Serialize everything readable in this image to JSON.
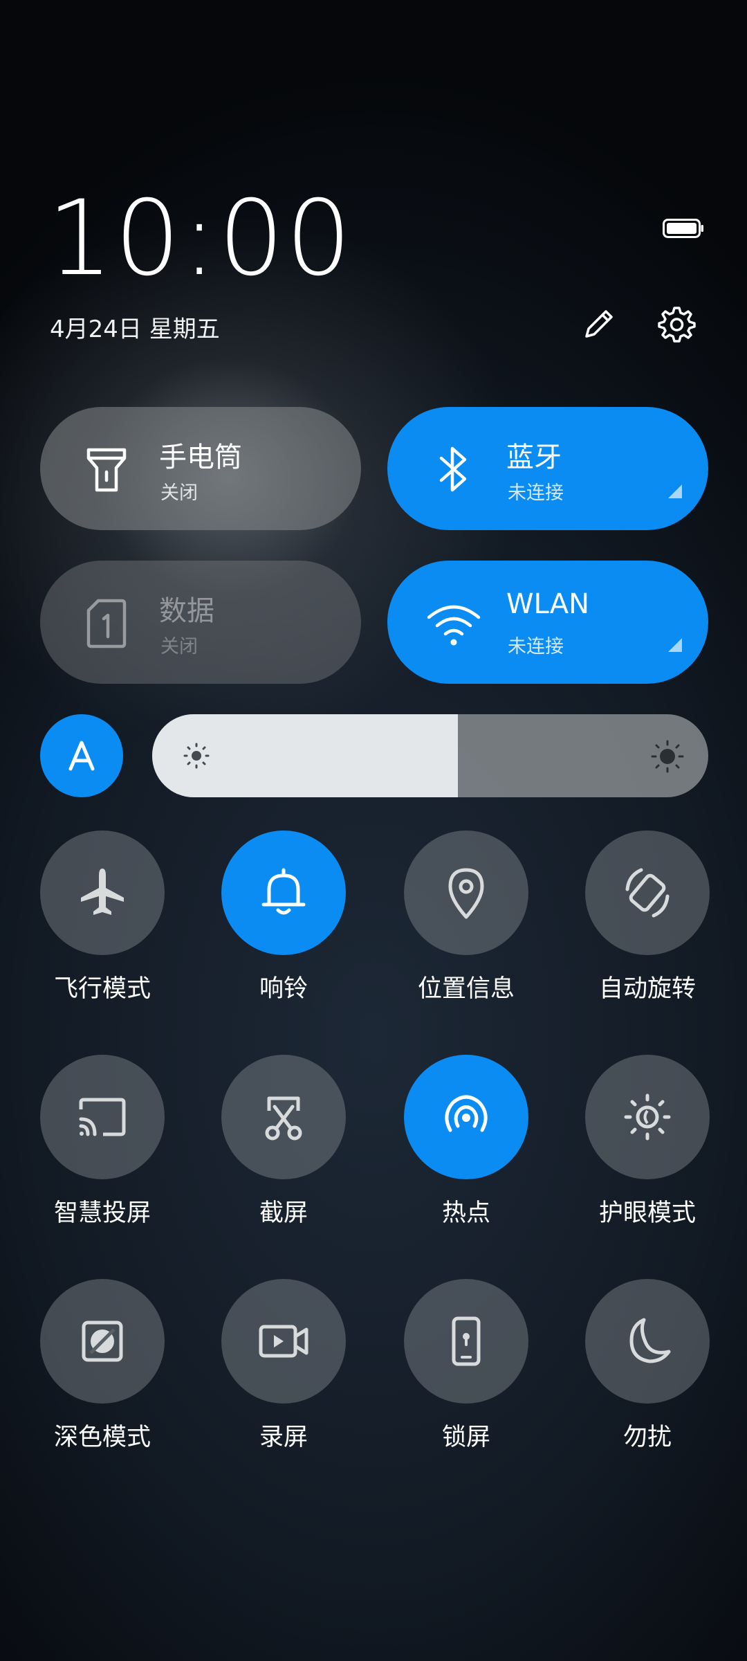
{
  "status": {
    "time": "10:00",
    "date": "4月24日 星期五",
    "icons": [
      "battery-icon",
      "edit-icon",
      "settings-icon"
    ]
  },
  "colors": {
    "accent": "#0a8cf2",
    "tile_off": "#7f8285",
    "icon_off": "#d8dadc"
  },
  "tiles": {
    "flashlight": {
      "title": "手电筒",
      "sub": "关闭",
      "icon": "flashlight-icon"
    },
    "bluetooth": {
      "title": "蓝牙",
      "sub": "未连接",
      "icon": "bluetooth-icon"
    },
    "data": {
      "title": "数据",
      "sub": "关闭",
      "icon": "sim-card-icon"
    },
    "wlan": {
      "title": "WLAN",
      "sub": "未连接",
      "icon": "wifi-icon"
    }
  },
  "brightness": {
    "auto_label": "A",
    "level": 0.55
  },
  "toggles": [
    {
      "label": "飞行模式",
      "icon": "airplane-icon",
      "on": false
    },
    {
      "label": "响铃",
      "icon": "bell-icon",
      "on": true
    },
    {
      "label": "位置信息",
      "icon": "location-icon",
      "on": false
    },
    {
      "label": "自动旋转",
      "icon": "rotate-icon",
      "on": false
    },
    {
      "label": "智慧投屏",
      "icon": "cast-icon",
      "on": false
    },
    {
      "label": "截屏",
      "icon": "scissors-icon",
      "on": false
    },
    {
      "label": "热点",
      "icon": "hotspot-icon",
      "on": true
    },
    {
      "label": "护眼模式",
      "icon": "eye-comfort-icon",
      "on": false
    },
    {
      "label": "深色模式",
      "icon": "dark-mode-icon",
      "on": false
    },
    {
      "label": "录屏",
      "icon": "screen-record-icon",
      "on": false
    },
    {
      "label": "锁屏",
      "icon": "lock-screen-icon",
      "on": false
    },
    {
      "label": "勿扰",
      "icon": "moon-icon",
      "on": false
    }
  ]
}
